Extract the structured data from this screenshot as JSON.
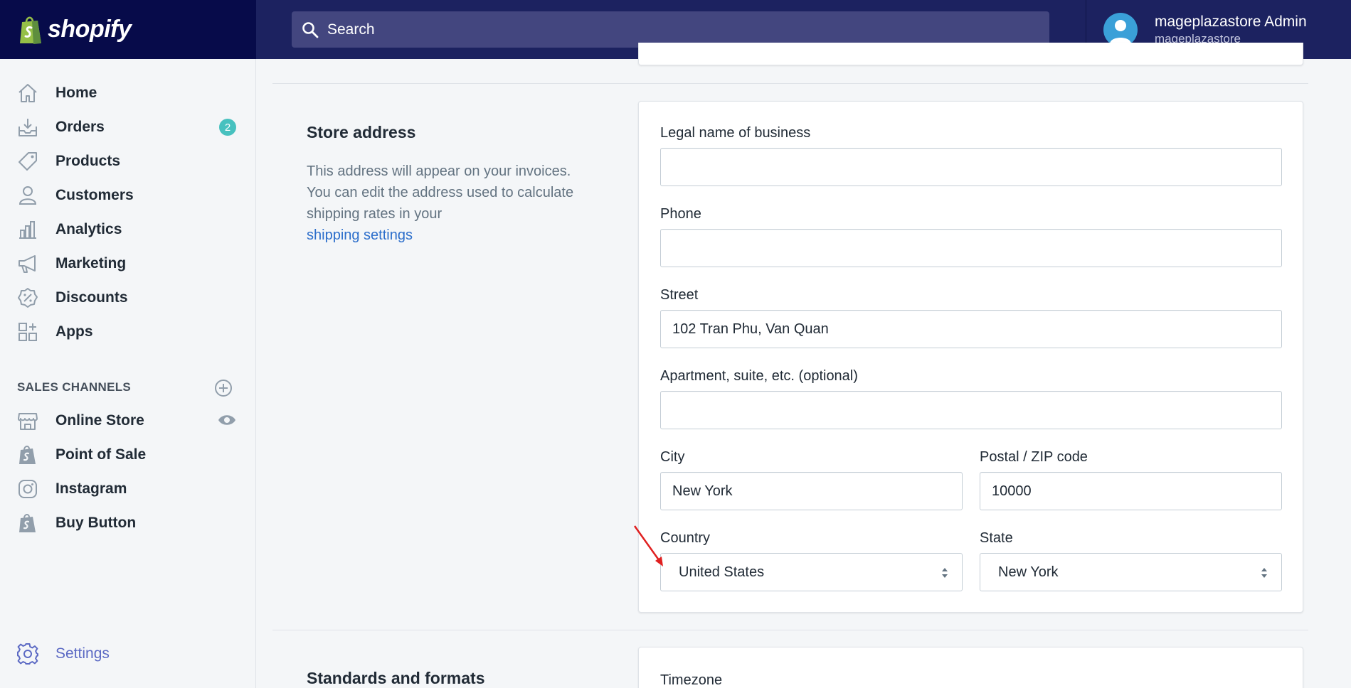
{
  "topbar": {
    "brand": "shopify",
    "search_placeholder": "Search",
    "user_name": "mageplazastore Admin",
    "store_name": "mageplazastore"
  },
  "sidebar": {
    "items": [
      {
        "label": "Home",
        "icon": "home-icon"
      },
      {
        "label": "Orders",
        "icon": "orders-icon",
        "badge": "2"
      },
      {
        "label": "Products",
        "icon": "tag-icon"
      },
      {
        "label": "Customers",
        "icon": "person-icon"
      },
      {
        "label": "Analytics",
        "icon": "bar-chart-icon"
      },
      {
        "label": "Marketing",
        "icon": "megaphone-icon"
      },
      {
        "label": "Discounts",
        "icon": "discount-icon"
      },
      {
        "label": "Apps",
        "icon": "apps-icon"
      }
    ],
    "sales_channels_title": "SALES CHANNELS",
    "channels": [
      {
        "label": "Online Store",
        "icon": "store-icon"
      },
      {
        "label": "Point of Sale",
        "icon": "shopify-bag-icon"
      },
      {
        "label": "Instagram",
        "icon": "instagram-icon"
      },
      {
        "label": "Buy Button",
        "icon": "shopify-bag-icon"
      }
    ],
    "settings_label": "Settings"
  },
  "store_address": {
    "title": "Store address",
    "description": "This address will appear on your invoices. You can edit the address used to calculate shipping rates in your",
    "link": "shipping settings",
    "fields": {
      "legal_name_label": "Legal name of business",
      "legal_name_value": "",
      "phone_label": "Phone",
      "phone_value": "",
      "street_label": "Street",
      "street_value": "102 Tran Phu, Van Quan",
      "apartment_label": "Apartment, suite, etc. (optional)",
      "apartment_value": "",
      "city_label": "City",
      "city_value": "New York",
      "postal_label": "Postal / ZIP code",
      "postal_value": "10000",
      "country_label": "Country",
      "country_value": "United States",
      "state_label": "State",
      "state_value": "New York"
    }
  },
  "standards": {
    "title": "Standards and formats",
    "timezone_label": "Timezone"
  },
  "colors": {
    "topbar": "#1c2260",
    "brand_bg": "#070b4a",
    "accent": "#5c6ac4",
    "badge": "#47c1bf",
    "link": "#2c6ecb",
    "annotation_arrow": "#e02020"
  }
}
